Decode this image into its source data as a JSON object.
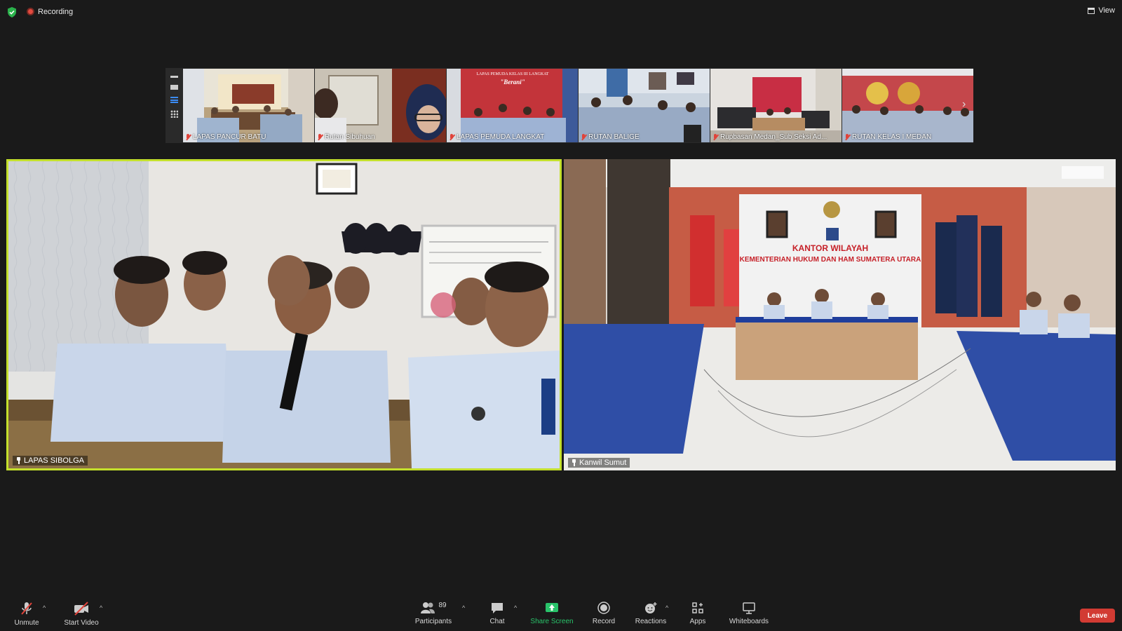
{
  "topbar": {
    "recording_label": "Recording",
    "view_label": "View"
  },
  "strip": {
    "thumbnails": [
      {
        "name": "LAPAS PANCUR BATU"
      },
      {
        "name": "Rutan Sibuhuan"
      },
      {
        "name": "LAPAS PEMUDA LANGKAT"
      },
      {
        "name": "RUTAN BALIGE"
      },
      {
        "name": "Rupbasan Medan_Sub Seksi Ad..."
      },
      {
        "name": "RUTAN KELAS I MEDAN"
      }
    ],
    "thumb_banner_langkat": "LAPAS PEMUDA KELAS III LANGKAT",
    "thumb_banner_langkat_sub": "\"Berani\""
  },
  "main": {
    "left_tile_name": "LAPAS SIBOLGA",
    "right_tile_name": "Kanwil Sumut",
    "right_banner_line1": "KANTOR WILAYAH",
    "right_banner_line2": "KEMENTERIAN HUKUM DAN HAM SUMATERA UTARA"
  },
  "toolbar": {
    "unmute_label": "Unmute",
    "start_video_label": "Start Video",
    "participants_label": "Participants",
    "participants_count": "89",
    "chat_label": "Chat",
    "share_screen_label": "Share Screen",
    "record_label": "Record",
    "reactions_label": "Reactions",
    "apps_label": "Apps",
    "whiteboards_label": "Whiteboards",
    "leave_label": "Leave"
  },
  "colors": {
    "active_speaker_border": "#c4e02c",
    "leave": "#d23b33",
    "share_green": "#29c36a",
    "recording": "#e34a3f"
  }
}
